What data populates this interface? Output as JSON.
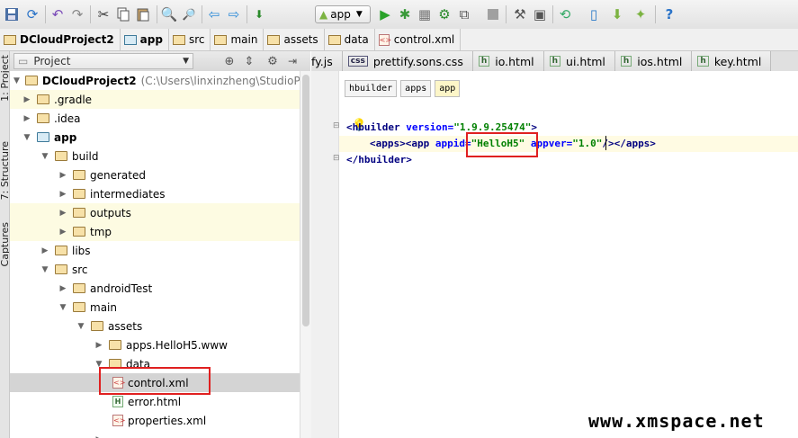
{
  "toolbar": {
    "run_config_label": "app",
    "icons": [
      "save-icon",
      "sync-icon",
      "undo-icon",
      "redo-icon",
      "cut-icon",
      "copy-icon",
      "paste-icon",
      "find-icon",
      "replace-icon",
      "back-icon",
      "forward-icon",
      "make-icon",
      "run-icon",
      "debug-icon",
      "coverage-icon",
      "attach-debugger-icon",
      "stop-icon",
      "settings-icon",
      "project-structure-icon",
      "avd-manager-icon",
      "sdk-manager-icon",
      "android-device-monitor-icon",
      "help-icon"
    ]
  },
  "breadcrumb": {
    "items": [
      "DCloudProject2",
      "app",
      "src",
      "main",
      "assets",
      "data",
      "control.xml"
    ]
  },
  "side_tabs": {
    "project": "1: Project",
    "structure": "7: Structure",
    "captures": "Captures"
  },
  "project_panel": {
    "view_label": "Project"
  },
  "tree": {
    "root_name": "DCloudProject2",
    "root_path": "(C:\\Users\\linxinzheng\\StudioProjects",
    "items": [
      {
        "label": "DCloudProject2"
      },
      {
        "label": ".gradle"
      },
      {
        "label": ".idea"
      },
      {
        "label": "app"
      },
      {
        "label": "build"
      },
      {
        "label": "generated"
      },
      {
        "label": "intermediates"
      },
      {
        "label": "outputs"
      },
      {
        "label": "tmp"
      },
      {
        "label": "libs"
      },
      {
        "label": "src"
      },
      {
        "label": "androidTest"
      },
      {
        "label": "main"
      },
      {
        "label": "assets"
      },
      {
        "label": "apps.HelloH5.www"
      },
      {
        "label": "data"
      },
      {
        "label": "control.xml"
      },
      {
        "label": "error.html"
      },
      {
        "label": "properties.xml"
      }
    ]
  },
  "editor": {
    "tabs": [
      "fy.js",
      "prettify.sons.css",
      "io.html",
      "ui.html",
      "ios.html",
      "key.html"
    ],
    "tag_breadcrumb": [
      "hbuilder",
      "apps",
      "app"
    ],
    "code": {
      "l1_open": "<hbuilder",
      "l1_attr": " version=",
      "l1_val": "\"1.9.9.25474\"",
      "l1_close": ">",
      "l2_apps": "<apps>",
      "l2_app": "<app",
      "l2_attr1": " appid=",
      "l2_val1": "\"HelloH5\"",
      "l2_attr2": " appver=",
      "l2_val2": "\"1.0\"",
      "l2_close": "/></apps>",
      "l3": "</hbuilder>"
    }
  },
  "watermark": "www.xmspace.net",
  "colors": {
    "highlight_box": "#e02020",
    "xml_tag": "#000080",
    "xml_attr": "#0000ff",
    "xml_value": "#008000"
  }
}
